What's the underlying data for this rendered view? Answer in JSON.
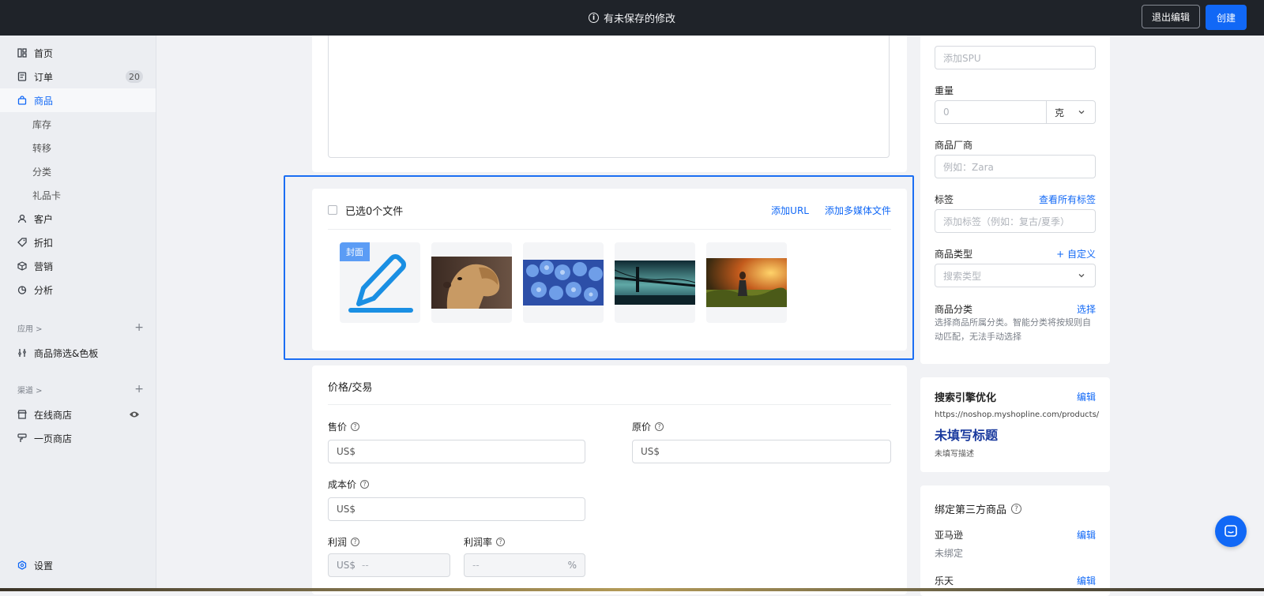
{
  "topbar": {
    "unsaved_text": "有未保存的修改",
    "exit_label": "退出编辑",
    "create_label": "创建"
  },
  "sidebar": {
    "items": [
      {
        "label": "首页",
        "icon": "home-icon"
      },
      {
        "label": "订单",
        "icon": "order-icon",
        "badge": "20"
      },
      {
        "label": "商品",
        "icon": "product-bag-icon",
        "active": true
      },
      {
        "label": "库存"
      },
      {
        "label": "转移"
      },
      {
        "label": "分类"
      },
      {
        "label": "礼品卡"
      },
      {
        "label": "客户",
        "icon": "customer-icon"
      },
      {
        "label": "折扣",
        "icon": "tag-icon"
      },
      {
        "label": "营销",
        "icon": "marketing-cube-icon"
      },
      {
        "label": "分析",
        "icon": "analytics-pie-icon"
      }
    ],
    "apps_section": "应用 >",
    "apps": [
      {
        "label": "商品筛选&色板",
        "icon": "filter-swatch-icon"
      }
    ],
    "channels_section": "渠道 >",
    "channels": [
      {
        "label": "在线商店",
        "icon": "store-icon"
      },
      {
        "label": "一页商店",
        "icon": "brush-icon"
      }
    ],
    "settings_label": "设置"
  },
  "media": {
    "selected_text": "已选0个文件",
    "add_url": "添加URL",
    "add_media": "添加多媒体文件",
    "cover_tag": "封面",
    "thumbnails": [
      "cover-edit-icon",
      "dog-photo",
      "hydrangea-photo",
      "bridge-photo",
      "girl-field-photo"
    ]
  },
  "pricing": {
    "title": "价格/交易",
    "sale_price_label": "售价",
    "original_price_label": "原价",
    "cost_price_label": "成本价",
    "profit_label": "利润",
    "profit_rate_label": "利润率",
    "currency_prefix": "US$",
    "empty_value": "--",
    "percent": "%"
  },
  "details": {
    "spu_placeholder": "添加SPU",
    "weight_label": "重量",
    "weight_placeholder": "0",
    "weight_unit": "克",
    "vendor_label": "商品厂商",
    "vendor_placeholder": "例如：Zara",
    "tags_label": "标签",
    "tags_link": "查看所有标签",
    "tags_placeholder": "添加标签（例如：复古/夏季）",
    "type_label": "商品类型",
    "type_link": "+ 自定义",
    "type_placeholder": "搜索类型",
    "category_label": "商品分类",
    "category_link": "选择",
    "category_note": "选择商品所属分类。智能分类将按规则自动匹配，无法手动选择"
  },
  "seo": {
    "title": "搜索引擎优化",
    "edit": "编辑",
    "url": "https://noshop.myshopline.com/products/",
    "page_title": "未填写标题",
    "description": "未填写描述"
  },
  "third_party": {
    "title": "绑定第三方商品",
    "amazon_label": "亚马逊",
    "amazon_edit": "编辑",
    "amazon_status": "未绑定",
    "rakuten_label": "乐天",
    "rakuten_edit": "编辑"
  }
}
